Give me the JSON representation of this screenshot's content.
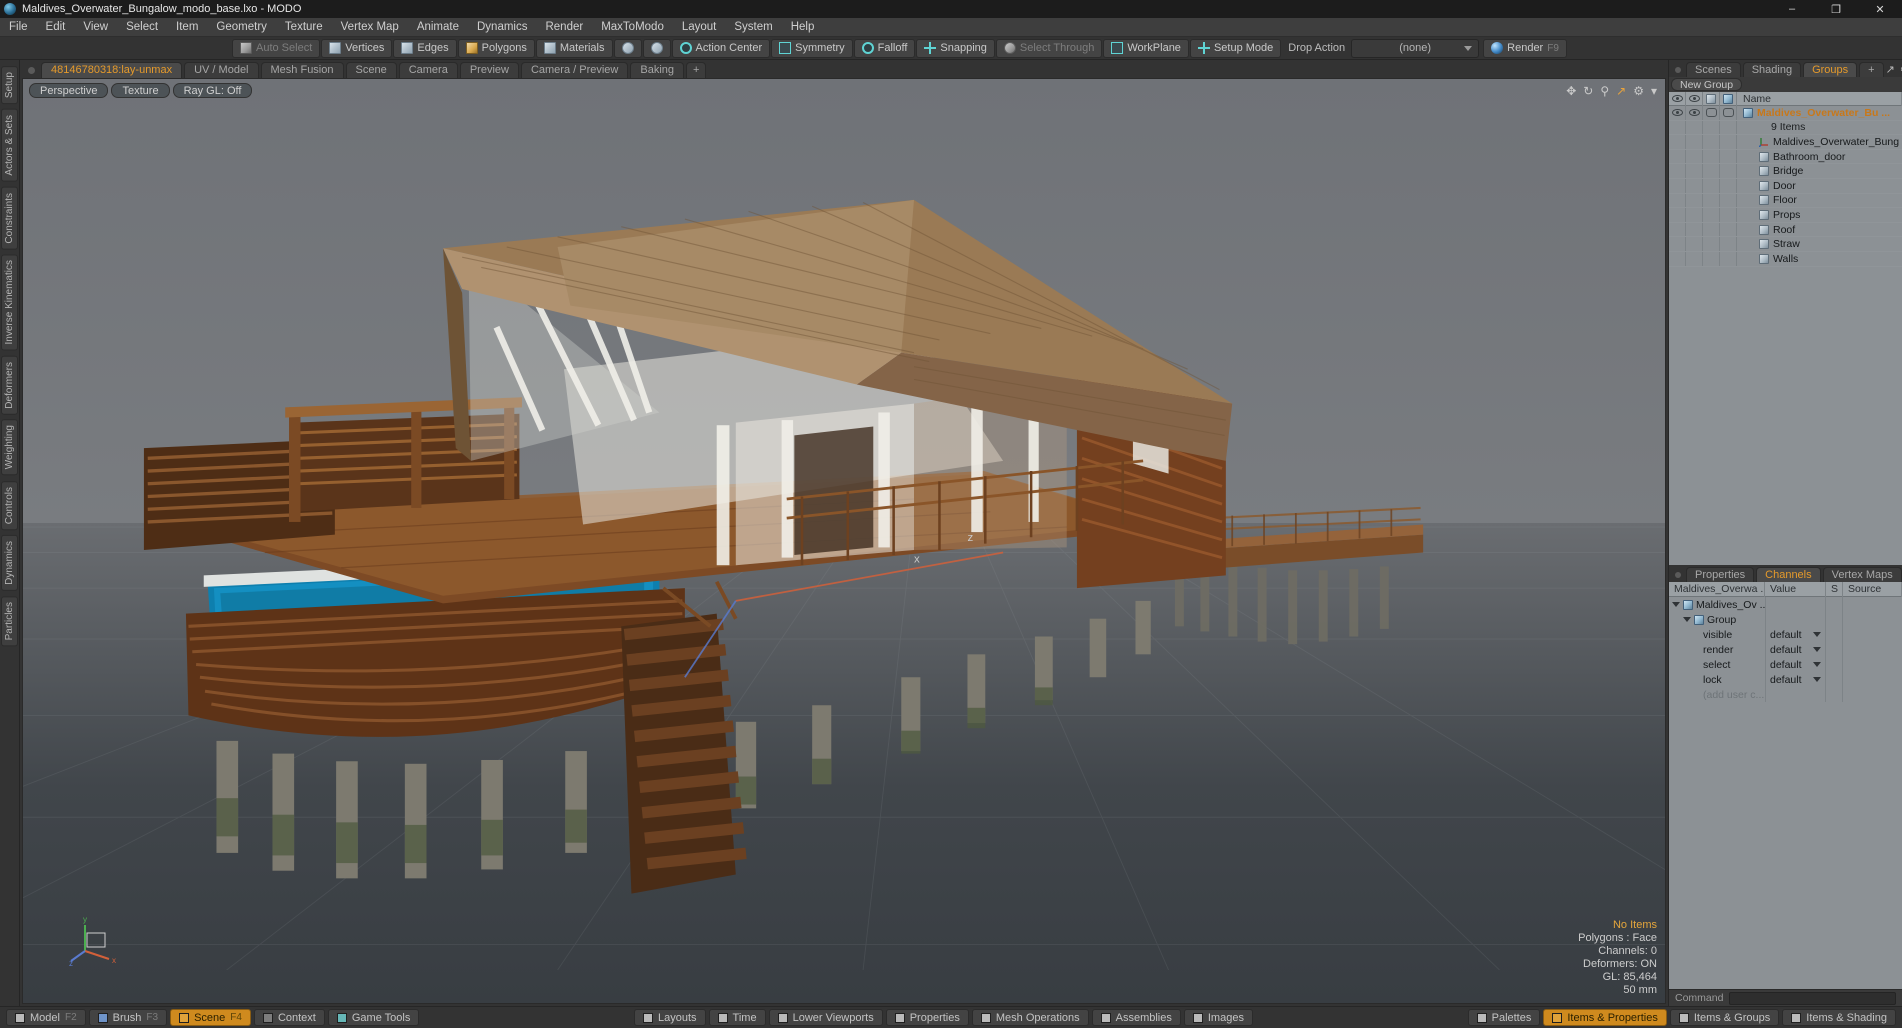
{
  "window": {
    "title": "Maldives_Overwater_Bungalow_modo_base.lxo - MODO",
    "app_icon": "modo-app-icon",
    "minimize": "–",
    "maximize": "❐",
    "close": "✕"
  },
  "menubar": {
    "items": [
      {
        "label": "File"
      },
      {
        "label": "Edit"
      },
      {
        "label": "View"
      },
      {
        "label": "Select"
      },
      {
        "label": "Item"
      },
      {
        "label": "Geometry"
      },
      {
        "label": "Texture"
      },
      {
        "label": "Vertex Map"
      },
      {
        "label": "Animate"
      },
      {
        "label": "Dynamics"
      },
      {
        "label": "Render"
      },
      {
        "label": "MaxToModo"
      },
      {
        "label": "Layout"
      },
      {
        "label": "System"
      },
      {
        "label": "Help"
      }
    ]
  },
  "toolbar": {
    "auto_select": "Auto Select",
    "vertices": "Vertices",
    "edges": "Edges",
    "polygons": "Polygons",
    "materials": "Materials",
    "action_center": "Action Center",
    "symmetry": "Symmetry",
    "falloff": "Falloff",
    "snapping": "Snapping",
    "select_through": "Select Through",
    "workplane": "WorkPlane",
    "setup_mode": "Setup Mode",
    "drop_action_label": "Drop Action",
    "drop_action_value": "(none)",
    "render": "Render",
    "render_key": "F9"
  },
  "left_strip": {
    "tabs": [
      {
        "label": "Setup"
      },
      {
        "label": "Actors & Sets"
      },
      {
        "label": "Constraints"
      },
      {
        "label": "Inverse Kinematics"
      },
      {
        "label": "Deformers"
      },
      {
        "label": "Weighting"
      },
      {
        "label": "Controls"
      },
      {
        "label": "Dynamics"
      },
      {
        "label": "Particles"
      }
    ]
  },
  "view_tabs": {
    "items": [
      {
        "label": "48146780318:lay-unmax",
        "active": true
      },
      {
        "label": "UV / Model",
        "active": false
      },
      {
        "label": "Mesh Fusion",
        "active": false
      },
      {
        "label": "Scene",
        "active": false
      },
      {
        "label": "Camera",
        "active": false
      },
      {
        "label": "Preview",
        "active": false
      },
      {
        "label": "Camera / Preview",
        "active": false
      },
      {
        "label": "Baking",
        "active": false
      },
      {
        "label": "+",
        "active": false
      }
    ]
  },
  "viewport": {
    "mode": "Perspective",
    "shading": "Texture",
    "raygl": "Ray GL: Off",
    "header_icons": [
      "pan-icon",
      "rotate-icon",
      "zoom-icon",
      "fit-icon",
      "settings-gear-icon",
      "dropdown-arrow-icon"
    ],
    "info": {
      "selection": "No Items",
      "polygons": "Polygons : Face",
      "channels": "Channels: 0",
      "deformers": "Deformers: ON",
      "gl": "GL: 85,464",
      "units": "50 mm"
    },
    "axis_labels": {
      "x": "x",
      "y": "y",
      "z": "z"
    }
  },
  "right_panel": {
    "tabs": [
      {
        "label": "Scenes",
        "active": false
      },
      {
        "label": "Shading",
        "active": false
      },
      {
        "label": "Groups",
        "active": true
      },
      {
        "label": "+",
        "active": false
      }
    ],
    "tools": [
      "expand-icon",
      "gear-icon"
    ],
    "new_group_button": "New Group",
    "columns": [
      "visible-eye-column",
      "render-column",
      "select-column",
      "lock-column",
      "Name"
    ],
    "name_column_label": "Name",
    "rows": [
      {
        "label": "Maldives_Overwater_Bu ...",
        "type": "group",
        "icon": "group-icon",
        "selected": true
      },
      {
        "label": "9 Items",
        "type": "count",
        "icon": "none"
      },
      {
        "label": "Maldives_Overwater_Bung ...",
        "type": "item",
        "icon": "locator-axis-icon"
      },
      {
        "label": "Bathroom_door",
        "type": "item",
        "icon": "mesh-icon"
      },
      {
        "label": "Bridge",
        "type": "item",
        "icon": "mesh-icon"
      },
      {
        "label": "Door",
        "type": "item",
        "icon": "mesh-icon"
      },
      {
        "label": "Floor",
        "type": "item",
        "icon": "mesh-icon"
      },
      {
        "label": "Props",
        "type": "item",
        "icon": "mesh-icon"
      },
      {
        "label": "Roof",
        "type": "item",
        "icon": "mesh-icon"
      },
      {
        "label": "Straw",
        "type": "item",
        "icon": "mesh-icon"
      },
      {
        "label": "Walls",
        "type": "item",
        "icon": "mesh-icon"
      }
    ]
  },
  "channels_panel": {
    "tabs": [
      {
        "label": "Properties",
        "active": false
      },
      {
        "label": "Channels",
        "active": true
      },
      {
        "label": "Vertex Maps",
        "active": false
      },
      {
        "label": "+",
        "active": false
      }
    ],
    "tools": [
      "expand-icon",
      "gear-icon"
    ],
    "columns": {
      "name": "Maldives_Overwa ...",
      "value": "Value",
      "s": "S",
      "source": "Source"
    },
    "rows": [
      {
        "name": "Maldives_Ov ...",
        "value": "",
        "depth": 0,
        "icon": "mesh-icon",
        "expander": true
      },
      {
        "name": "Group",
        "value": "",
        "depth": 1,
        "icon": "group-icon",
        "expander": true
      },
      {
        "name": "visible",
        "value": "default",
        "depth": 2,
        "icon": "none",
        "dropdown": true
      },
      {
        "name": "render",
        "value": "default",
        "depth": 2,
        "icon": "none",
        "dropdown": true
      },
      {
        "name": "select",
        "value": "default",
        "depth": 2,
        "icon": "none",
        "dropdown": true
      },
      {
        "name": "lock",
        "value": "default",
        "depth": 2,
        "icon": "none",
        "dropdown": true
      },
      {
        "name": "(add user c...",
        "value": "",
        "depth": 2,
        "icon": "none",
        "dim": true
      }
    ],
    "command_label": "Command",
    "command_value": ""
  },
  "bottom_bar": {
    "left_items": [
      {
        "label": "Model",
        "key": "F2",
        "swatch": "sw-gray",
        "active": false
      },
      {
        "label": "Brush",
        "key": "F3",
        "swatch": "sw-blue",
        "active": false
      },
      {
        "label": "Scene",
        "key": "F4",
        "swatch": "sw-amber",
        "active": true
      },
      {
        "label": "Context",
        "key": "",
        "swatch": "sw-dark",
        "active": false
      },
      {
        "label": "Game Tools",
        "key": "",
        "swatch": "sw-teal",
        "active": false
      }
    ],
    "center_items": [
      {
        "label": "Layouts"
      },
      {
        "label": "Time"
      },
      {
        "label": "Lower Viewports"
      },
      {
        "label": "Properties"
      },
      {
        "label": "Mesh Operations"
      },
      {
        "label": "Assemblies"
      },
      {
        "label": "Images"
      }
    ],
    "right_items": [
      {
        "label": "Palettes",
        "active": false
      },
      {
        "label": "Items & Properties",
        "active": true
      },
      {
        "label": "Items & Groups",
        "active": false
      },
      {
        "label": "Items & Shading",
        "active": false
      }
    ]
  },
  "colors": {
    "accent": "#e59a2b",
    "panel": "#333333",
    "list_bg": "#8c9195",
    "viewport_sky": "#6f7277",
    "viewport_ground": "#41464b",
    "water": "#1279a0",
    "wood": "#6b3c1e",
    "thatch": "#8b6a47"
  }
}
